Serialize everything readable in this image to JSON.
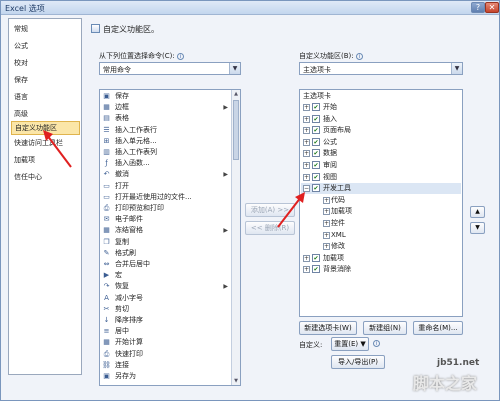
{
  "window": {
    "title": "Excel 选项",
    "help_label": "?",
    "close_label": "✕"
  },
  "sidebar": {
    "items": [
      {
        "label": "常规"
      },
      {
        "label": "公式"
      },
      {
        "label": "校对"
      },
      {
        "label": "保存"
      },
      {
        "label": "语言"
      },
      {
        "label": "高级"
      },
      {
        "label": "自定义功能区",
        "selected": true
      },
      {
        "label": "快速访问工具栏"
      },
      {
        "label": "加载项"
      },
      {
        "label": "信任中心"
      }
    ]
  },
  "main": {
    "heading": "自定义功能区。",
    "left_label": "从下列位置选择命令(C):",
    "left_combo": "常用命令",
    "right_label": "自定义功能区(B):",
    "right_combo": "主选项卡",
    "commands": [
      {
        "icon": "save-icon",
        "label": "保存"
      },
      {
        "icon": "border-icon",
        "label": "边框",
        "sub": "▶"
      },
      {
        "icon": "table-icon",
        "label": "表格"
      },
      {
        "icon": "insert-rows-icon",
        "label": "插入工作表行"
      },
      {
        "icon": "insert-cells-icon",
        "label": "插入单元格..."
      },
      {
        "icon": "insert-columns-icon",
        "label": "插入工作表列"
      },
      {
        "icon": "function-icon",
        "label": "插入函数..."
      },
      {
        "icon": "undo-icon",
        "label": "撤消",
        "sub": "▶"
      },
      {
        "icon": "open-icon",
        "label": "打开"
      },
      {
        "icon": "open-recent-icon",
        "label": "打开最近使用过的文件..."
      },
      {
        "icon": "print-preview-icon",
        "label": "打印预览和打印"
      },
      {
        "icon": "email-icon",
        "label": "电子邮件"
      },
      {
        "icon": "add-pane-icon",
        "label": "冻结窗格",
        "sub": "▶"
      },
      {
        "icon": "copy-icon",
        "label": "复制"
      },
      {
        "icon": "format-painter-icon",
        "label": "格式刷"
      },
      {
        "icon": "merge-center-icon",
        "label": "合并后居中"
      },
      {
        "icon": "macro-icon",
        "label": "宏"
      },
      {
        "icon": "redo-icon",
        "label": "恢复",
        "sub": "▶"
      },
      {
        "icon": "decrease-font-icon",
        "label": "减小字号"
      },
      {
        "icon": "cut-icon",
        "label": "剪切"
      },
      {
        "icon": "sort-icon",
        "label": "降序排序"
      },
      {
        "icon": "center-icon",
        "label": "居中"
      },
      {
        "icon": "calculate-icon",
        "label": "开始计算"
      },
      {
        "icon": "quick-print-icon",
        "label": "快速打印"
      },
      {
        "icon": "link-icon",
        "label": "连接"
      },
      {
        "icon": "save-as-icon",
        "label": "另存为"
      }
    ],
    "add_button": "添加(A) >>",
    "remove_button": "<< 删除(R)",
    "tabs_header": "主选项卡",
    "tabs": [
      {
        "label": "开始",
        "checked": true
      },
      {
        "label": "插入",
        "checked": true
      },
      {
        "label": "页面布局",
        "checked": true
      },
      {
        "label": "公式",
        "checked": true
      },
      {
        "label": "数据",
        "checked": true
      },
      {
        "label": "审阅",
        "checked": true
      },
      {
        "label": "视图",
        "checked": true
      },
      {
        "label": "开发工具",
        "checked": true,
        "expanded": true,
        "selected": true
      },
      {
        "label": "代码",
        "child": true
      },
      {
        "label": "加载项",
        "child": true
      },
      {
        "label": "控件",
        "child": true
      },
      {
        "label": "XML",
        "child": true
      },
      {
        "label": "修改",
        "child": true
      },
      {
        "label": "加载项",
        "checked": true
      },
      {
        "label": "背景消除",
        "checked": true
      }
    ],
    "move_up": "▲",
    "move_down": "▼",
    "new_tab_button": "新建选项卡(W)",
    "new_group_button": "新建组(N)",
    "rename_button": "重命名(M)...",
    "customize_label": "自定义:",
    "reset_button": "重置(E) ▼",
    "import_export_button": "导入/导出(P)"
  },
  "watermark": {
    "site": "jb51.net",
    "brand": "脚本之家"
  }
}
